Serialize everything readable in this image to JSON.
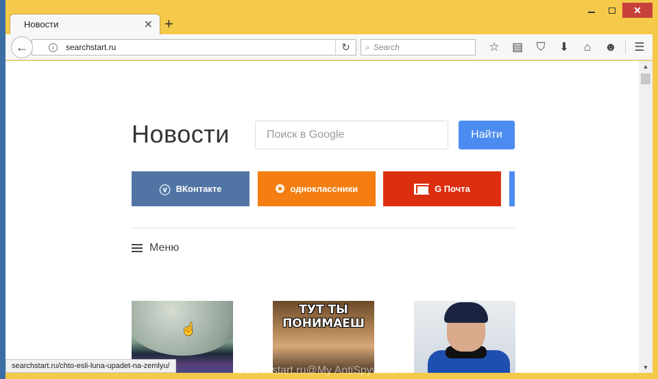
{
  "window": {
    "controls": {
      "minimize": "minimize",
      "maximize": "maximize",
      "close": "✕"
    }
  },
  "tab": {
    "title": "Новости",
    "close": "✕",
    "new_tab": "+"
  },
  "toolbar": {
    "back": "←",
    "info": "i",
    "url": "searchstart.ru",
    "reload": "↻",
    "search_mag": "⌕",
    "search_placeholder": "Search",
    "icons": [
      "star-icon",
      "reading-list-icon",
      "pocket-icon",
      "download-icon",
      "home-icon",
      "smiley-icon",
      "menu-icon"
    ]
  },
  "page": {
    "logo": "Новости",
    "search_placeholder": "Поиск в Google",
    "search_button": "Найти",
    "tiles": [
      {
        "label": "ВКонтакте",
        "icon": "vk-icon",
        "color": "#5075a4"
      },
      {
        "label": "одноклассники",
        "icon": "ok-icon",
        "color": "#f57e12"
      },
      {
        "label": "G Почта",
        "icon": "gmail-icon",
        "color": "#dc2f10"
      }
    ],
    "menu_label": "Меню",
    "meme_caption": "ТУТ ТЫ ПОНИМАЕШ"
  },
  "status": {
    "link": "searchstart.ru/chto-esli-luna-upadet-na-zemlyu/"
  },
  "watermark": "Searchstart.ru@My AntiSpyware"
}
